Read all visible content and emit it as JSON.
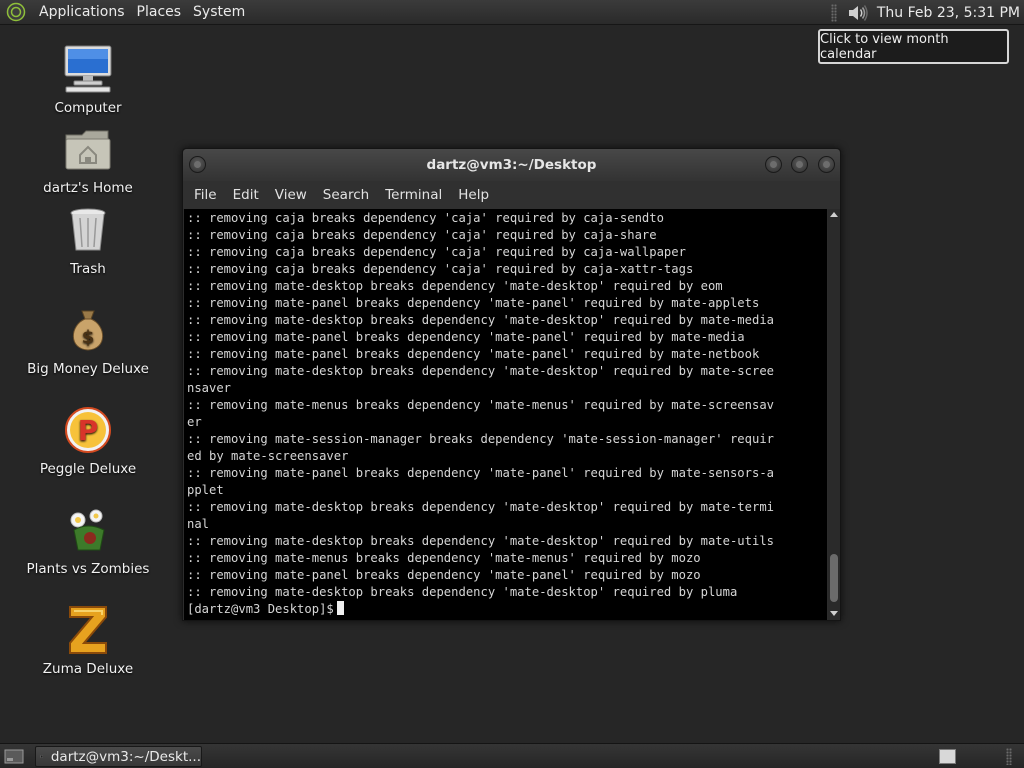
{
  "top_panel": {
    "menus": [
      "Applications",
      "Places",
      "System"
    ],
    "clock": "Thu Feb 23,  5:31 PM",
    "tooltip": "Click to view month calendar"
  },
  "desktop_icons": [
    {
      "label": "Computer",
      "icon": "computer-icon"
    },
    {
      "label": "dartz's Home",
      "icon": "home-folder-icon"
    },
    {
      "label": "Trash",
      "icon": "trash-icon"
    },
    {
      "label": "Big Money Deluxe",
      "icon": "money-bag-icon"
    },
    {
      "label": "Peggle Deluxe",
      "icon": "peggle-icon"
    },
    {
      "label": "Plants vs Zombies",
      "icon": "plants-vs-zombies-icon"
    },
    {
      "label": "Zuma Deluxe",
      "icon": "zuma-icon"
    }
  ],
  "terminal": {
    "title": "dartz@vm3:~/Desktop",
    "menus": [
      "File",
      "Edit",
      "View",
      "Search",
      "Terminal",
      "Help"
    ],
    "lines": [
      ":: removing caja breaks dependency 'caja' required by caja-sendto",
      ":: removing caja breaks dependency 'caja' required by caja-share",
      ":: removing caja breaks dependency 'caja' required by caja-wallpaper",
      ":: removing caja breaks dependency 'caja' required by caja-xattr-tags",
      ":: removing mate-desktop breaks dependency 'mate-desktop' required by eom",
      ":: removing mate-panel breaks dependency 'mate-panel' required by mate-applets",
      ":: removing mate-desktop breaks dependency 'mate-desktop' required by mate-media",
      ":: removing mate-panel breaks dependency 'mate-panel' required by mate-media",
      ":: removing mate-panel breaks dependency 'mate-panel' required by mate-netbook",
      ":: removing mate-desktop breaks dependency 'mate-desktop' required by mate-scree",
      "nsaver",
      ":: removing mate-menus breaks dependency 'mate-menus' required by mate-screensav",
      "er",
      ":: removing mate-session-manager breaks dependency 'mate-session-manager' requir",
      "ed by mate-screensaver",
      ":: removing mate-panel breaks dependency 'mate-panel' required by mate-sensors-a",
      "pplet",
      ":: removing mate-desktop breaks dependency 'mate-desktop' required by mate-termi",
      "nal",
      ":: removing mate-desktop breaks dependency 'mate-desktop' required by mate-utils",
      ":: removing mate-menus breaks dependency 'mate-menus' required by mozo",
      ":: removing mate-panel breaks dependency 'mate-panel' required by mozo",
      ":: removing mate-desktop breaks dependency 'mate-desktop' required by pluma"
    ],
    "prompt": "[dartz@vm3 Desktop]$"
  },
  "taskbar": {
    "task_label": "dartz@vm3:~/Deskt..."
  }
}
